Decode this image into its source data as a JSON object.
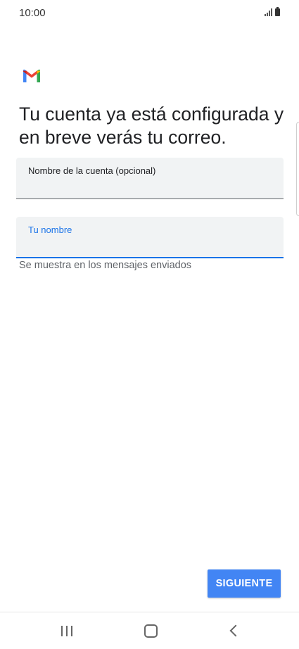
{
  "status_bar": {
    "time": "10:00",
    "icons": [
      "signal-icon",
      "battery-icon"
    ]
  },
  "app": {
    "logo": "gmail-logo-icon",
    "colors": {
      "blue": "#4285f4",
      "red": "#ea4335",
      "yellow": "#fbbc04",
      "green": "#34a853",
      "accent": "#1a73e8"
    }
  },
  "heading": "Tu cuenta ya está configurada y en breve verás tu correo.",
  "form": {
    "account_name": {
      "label": "Nombre de la cuenta (opcional)",
      "value": ""
    },
    "your_name": {
      "label": "Tu nombre",
      "value": "",
      "helper": "Se muestra en los mensajes enviados"
    }
  },
  "actions": {
    "next_label": "SIGUIENTE"
  },
  "nav_bar": {
    "icons": [
      "recents-icon",
      "home-icon",
      "back-icon"
    ]
  }
}
